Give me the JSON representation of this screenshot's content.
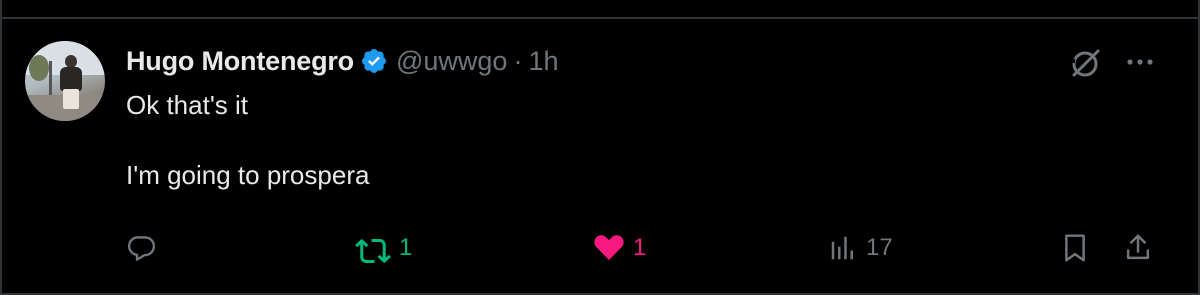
{
  "post": {
    "author": {
      "display_name": "Hugo Montenegro",
      "handle": "@uwwgo",
      "verified": true,
      "avatar_icon": "user-avatar-photo"
    },
    "separator": "·",
    "timestamp": "1h",
    "text": "Ok that's it\n\nI'm going to prospera",
    "header_icons": [
      "grok-icon",
      "more-options-icon"
    ],
    "actions": {
      "reply": {
        "icon": "reply-icon",
        "count": ""
      },
      "retweet": {
        "icon": "retweet-icon",
        "count": "1",
        "active": true,
        "color": "#00ba7c"
      },
      "like": {
        "icon": "heart-icon",
        "count": "1",
        "active": true,
        "color": "#f91880"
      },
      "views": {
        "icon": "views-icon",
        "count": "17"
      },
      "bookmark": {
        "icon": "bookmark-icon"
      },
      "share": {
        "icon": "share-icon"
      }
    }
  },
  "theme": {
    "background": "#000000",
    "text_primary": "#e7e9ea",
    "text_secondary": "#71767b",
    "verified_blue": "#1d9bf0",
    "border": "#2f3336"
  }
}
